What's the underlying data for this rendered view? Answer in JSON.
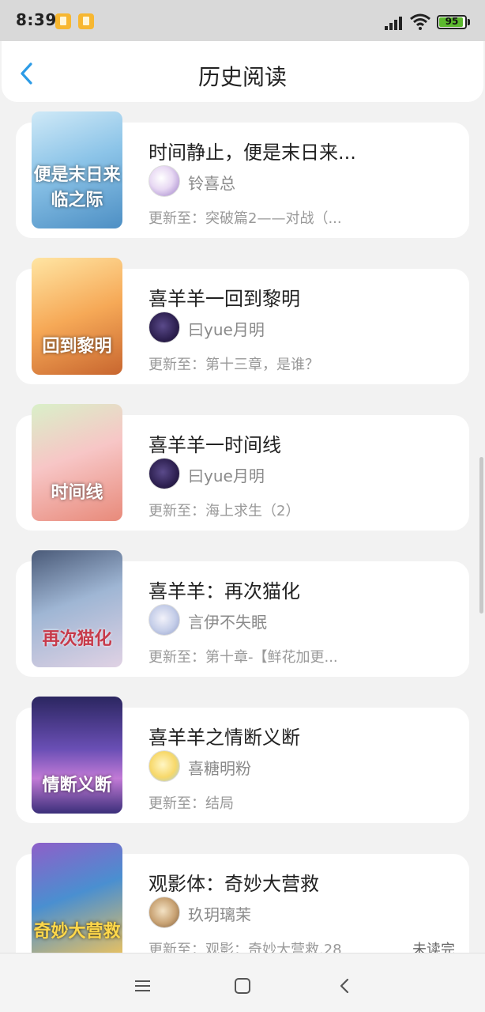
{
  "status_bar": {
    "time": "8:39",
    "battery": "95",
    "icons": [
      "app-notification-icon",
      "app-notification-icon",
      "signal-icon",
      "wifi-icon",
      "battery-icon"
    ]
  },
  "header": {
    "title": "历史阅读",
    "back_icon": "back-chevron-icon",
    "accent_color": "#2c9be6"
  },
  "books": [
    {
      "title": "时间静止，便是末日来...",
      "author": "铃喜总",
      "update": "更新至：突破篇2——对战（...",
      "cover_text": "便是末日来临之际",
      "unread": ""
    },
    {
      "title": "喜羊羊一回到黎明",
      "author": "曰yue月明",
      "update": "更新至：第十三章，是谁？",
      "cover_text": "回到黎明",
      "unread": ""
    },
    {
      "title": "喜羊羊一时间线",
      "author": "曰yue月明",
      "update": "更新至：海上求生（2）",
      "cover_text": "时间线",
      "unread": ""
    },
    {
      "title": "喜羊羊：再次猫化",
      "author": "言伊不失眠",
      "update": "更新至：第十章-【鲜花加更...",
      "cover_text": "再次猫化",
      "unread": ""
    },
    {
      "title": "喜羊羊之情断义断",
      "author": "喜糖明粉",
      "update": "更新至：结局",
      "cover_text": "情断义断",
      "unread": ""
    },
    {
      "title": "观影体：奇妙大营救",
      "author": "玖玥璃茉",
      "update": "更新至：观影：奇妙大营救.28",
      "cover_text": "奇妙大营救",
      "unread": "未读完"
    }
  ],
  "nav_bar": {
    "icons": [
      "menu-icon",
      "home-icon",
      "back-icon"
    ]
  }
}
